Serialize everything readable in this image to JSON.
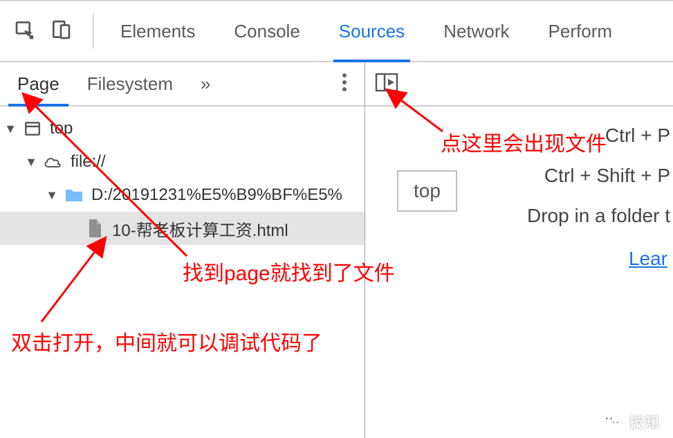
{
  "topTabs": {
    "elements": "Elements",
    "console": "Console",
    "sources": "Sources",
    "network": "Network",
    "performance": "Perform"
  },
  "subTabs": {
    "page": "Page",
    "filesystem": "Filesystem",
    "more": "»"
  },
  "tree": {
    "top": "top",
    "scheme": "file://",
    "folder": "D:/20191231%E5%B9%BF%E5%",
    "file": "10-帮老板计算工资.html"
  },
  "rightPanel": {
    "tooltip": "top",
    "hint1": "Ctrl + P",
    "hint2": "Ctrl + Shift + P",
    "hint3": "Drop in a folder t",
    "learn": "Lear"
  },
  "annotations": {
    "a1": "点这里会出现文件",
    "a2": "找到page就找到了文件",
    "a3": "双击打开，中间就可以调试代码了"
  },
  "watermark": "技知"
}
